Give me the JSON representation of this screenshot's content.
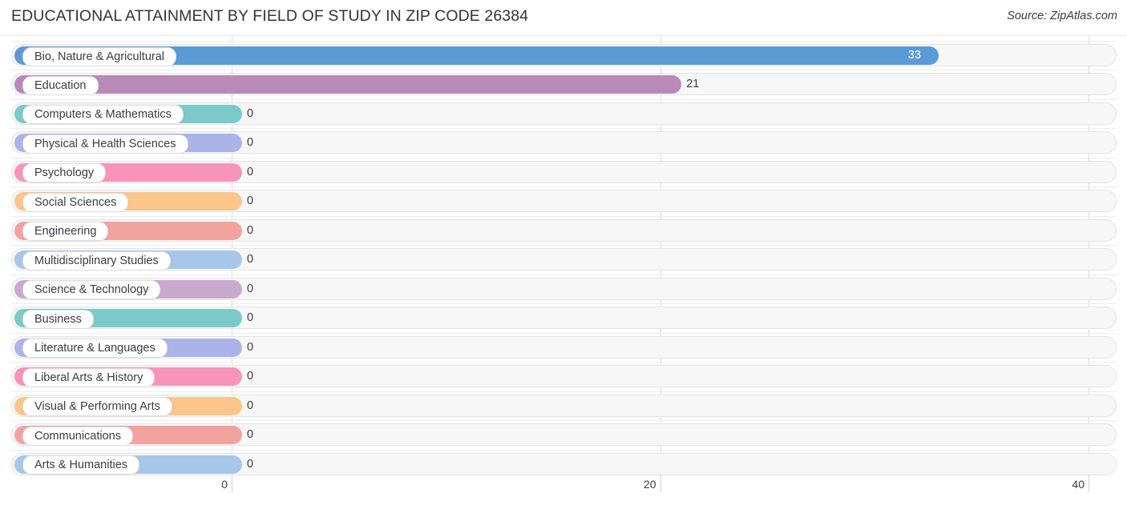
{
  "header": {
    "title": "EDUCATIONAL ATTAINMENT BY FIELD OF STUDY IN ZIP CODE 26384",
    "source": "Source: ZipAtlas.com"
  },
  "chart_data": {
    "type": "bar",
    "orientation": "horizontal",
    "title": "EDUCATIONAL ATTAINMENT BY FIELD OF STUDY IN ZIP CODE 26384",
    "xlabel": "",
    "ylabel": "",
    "xlim": [
      0,
      40
    ],
    "xticks": [
      0,
      20,
      40
    ],
    "xtick_labels": [
      "0",
      "20",
      "40"
    ],
    "grid": true,
    "legend": false,
    "categories": [
      "Bio, Nature & Agricultural",
      "Education",
      "Computers & Mathematics",
      "Physical & Health Sciences",
      "Psychology",
      "Social Sciences",
      "Engineering",
      "Multidisciplinary Studies",
      "Science & Technology",
      "Business",
      "Literature & Languages",
      "Liberal Arts & History",
      "Visual & Performing Arts",
      "Communications",
      "Arts & Humanities"
    ],
    "values": [
      33,
      21,
      0,
      0,
      0,
      0,
      0,
      0,
      0,
      0,
      0,
      0,
      0,
      0,
      0
    ],
    "value_labels": [
      "33",
      "21",
      "0",
      "0",
      "0",
      "0",
      "0",
      "0",
      "0",
      "0",
      "0",
      "0",
      "0",
      "0",
      "0"
    ],
    "colors": [
      "#5b9bd5",
      "#b98ab8",
      "#7cc9ca",
      "#aab4e8",
      "#f794b8",
      "#fbc58b",
      "#f2a3a0",
      "#a7c7ea",
      "#c9a9cd",
      "#7cc9ca",
      "#aab4e8",
      "#f794b8",
      "#fbc58b",
      "#f2a3a0",
      "#a7c7ea"
    ]
  },
  "style": {
    "track_fill": "#f7f7f7",
    "track_border": "#e3e3e3",
    "gridline": "#dcdcdc",
    "text": "#3b3b42"
  }
}
